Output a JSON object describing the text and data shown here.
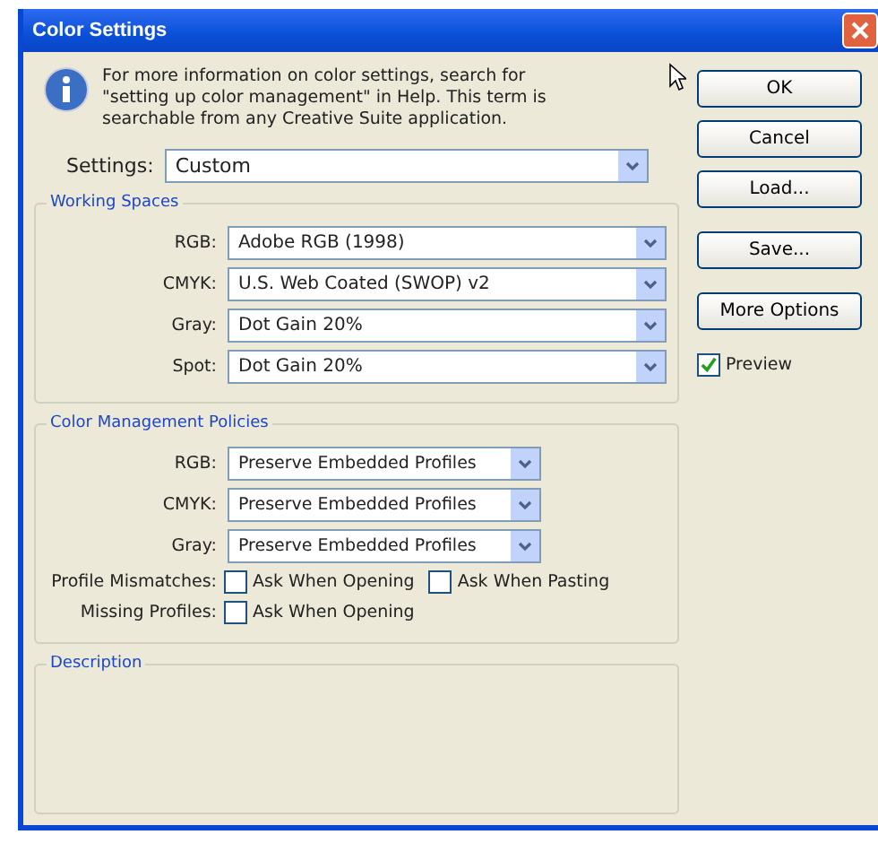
{
  "window": {
    "title": "Color Settings"
  },
  "info": "For more information on color settings, search for \"setting up color management\" in Help. This term is searchable from any Creative Suite application.",
  "settings": {
    "label": "Settings:",
    "value": "Custom"
  },
  "working_spaces": {
    "title": "Working Spaces",
    "rows": [
      {
        "label": "RGB:",
        "value": "Adobe RGB (1998)"
      },
      {
        "label": "CMYK:",
        "value": "U.S. Web Coated (SWOP) v2"
      },
      {
        "label": "Gray:",
        "value": "Dot Gain 20%"
      },
      {
        "label": "Spot:",
        "value": "Dot Gain 20%"
      }
    ]
  },
  "policies": {
    "title": "Color Management Policies",
    "rows": [
      {
        "label": "RGB:",
        "value": "Preserve Embedded Profiles"
      },
      {
        "label": "CMYK:",
        "value": "Preserve Embedded Profiles"
      },
      {
        "label": "Gray:",
        "value": "Preserve Embedded Profiles"
      }
    ],
    "checks": [
      {
        "label": "Profile Mismatches:",
        "options": [
          {
            "label": "Ask When Opening",
            "checked": false
          },
          {
            "label": "Ask When Pasting",
            "checked": false
          }
        ]
      },
      {
        "label": "Missing Profiles:",
        "options": [
          {
            "label": "Ask When Opening",
            "checked": false
          }
        ]
      }
    ]
  },
  "description": {
    "title": "Description"
  },
  "buttons": [
    "OK",
    "Cancel",
    "Load...",
    "Save...",
    "More Options"
  ],
  "preview": {
    "label": "Preview",
    "checked": true
  }
}
